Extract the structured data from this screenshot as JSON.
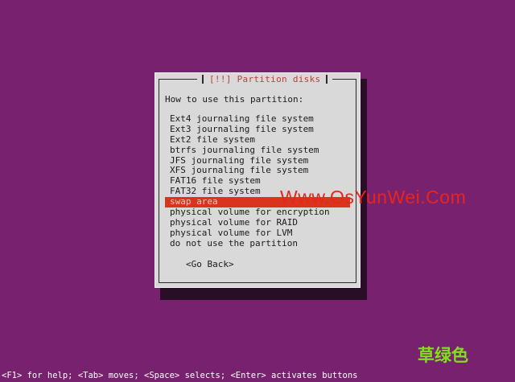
{
  "dialog": {
    "title": "[!!] Partition disks",
    "prompt": "How to use this partition:",
    "options": [
      "Ext4 journaling file system",
      "Ext3 journaling file system",
      "Ext2 file system",
      "btrfs journaling file system",
      "JFS journaling file system",
      "XFS journaling file system",
      "FAT16 file system",
      "FAT32 file system",
      "swap area",
      "physical volume for encryption",
      "physical volume for RAID",
      "physical volume for LVM",
      "do not use the partition"
    ],
    "selected_option": "swap area",
    "go_back_label": "<Go Back>"
  },
  "watermark": {
    "text": "Www.OsYunWei.Com",
    "logo_text": "草绿色"
  },
  "help_bar": {
    "text": "<F1> for help; <Tab> moves; <Space> selects; <Enter> activates buttons"
  },
  "colors": {
    "background": "#77216f",
    "dialog": "#d9d9d9",
    "title": "#b04438",
    "selection": "#d9341e",
    "watermark": "#e8251d",
    "logo": "#7fe01b"
  }
}
